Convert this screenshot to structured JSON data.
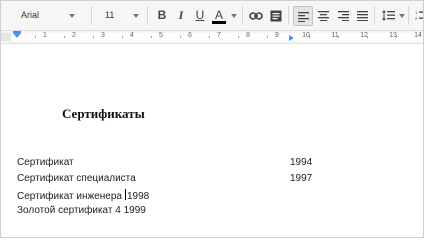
{
  "toolbar": {
    "font_name": "Arial",
    "font_size": "11",
    "bold": "B",
    "italic": "I",
    "underline": "U",
    "text_color": "A"
  },
  "ruler": {
    "numbers": [
      "1",
      "2",
      "3",
      "4",
      "5",
      "6",
      "7",
      "8",
      "9",
      "10",
      "11",
      "12",
      "13",
      "14"
    ]
  },
  "document": {
    "heading": "Сертификаты",
    "lines": [
      {
        "text": "Сертификат",
        "year": "1994"
      },
      {
        "text": "Сертификат специалиста",
        "year": "1997"
      },
      {
        "text_before": "Сертификат инженера",
        "text_after": "1998"
      },
      {
        "text": "Золотой сертификат 4 1999"
      }
    ]
  }
}
